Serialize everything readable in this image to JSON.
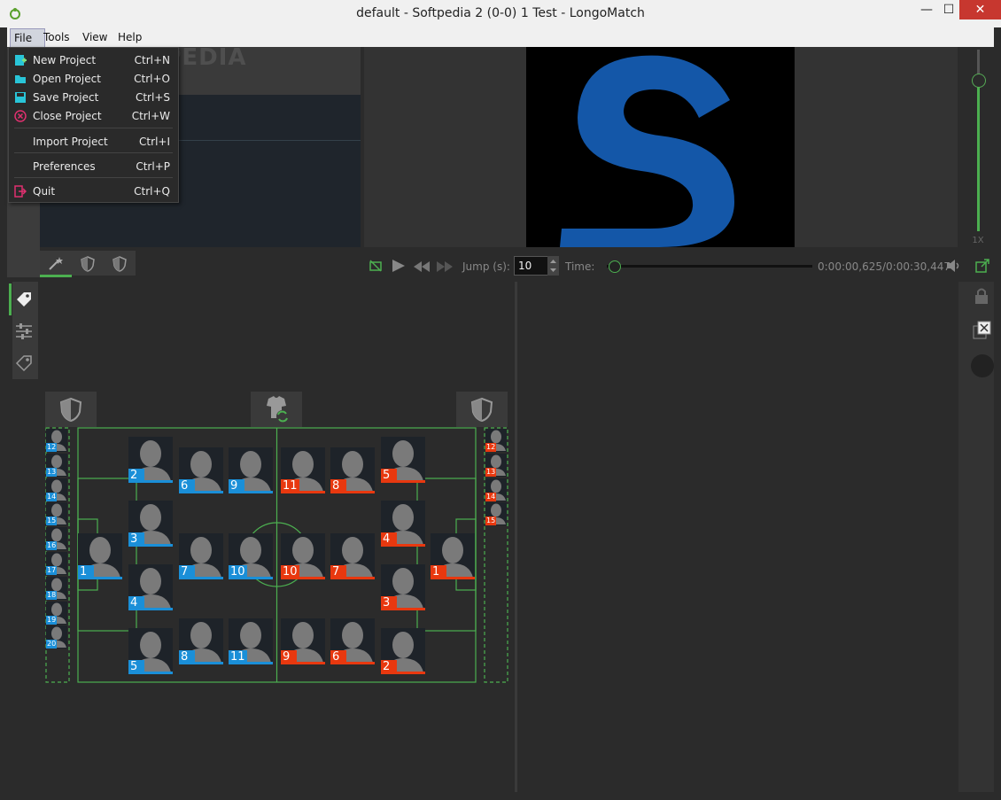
{
  "window": {
    "title": "default - Softpedia 2 (0-0) 1 Test - LongoMatch",
    "minimize": "—",
    "maximize": "☐",
    "close": "✕"
  },
  "menubar": {
    "file": "File",
    "tools": "Tools",
    "view": "View",
    "help": "Help"
  },
  "file_menu": {
    "items": [
      {
        "label": "New Project",
        "shortcut": "Ctrl+N",
        "icon": "new-project-icon"
      },
      {
        "label": "Open Project",
        "shortcut": "Ctrl+O",
        "icon": "open-folder-icon"
      },
      {
        "label": "Save Project",
        "shortcut": "Ctrl+S",
        "icon": "save-icon"
      },
      {
        "label": "Close Project",
        "shortcut": "Ctrl+W",
        "icon": "close-circle-icon"
      },
      {
        "label": "Import Project",
        "shortcut": "Ctrl+I"
      },
      {
        "label": "Preferences",
        "shortcut": "Ctrl+P"
      },
      {
        "label": "Quit",
        "shortcut": "Ctrl+Q",
        "icon": "quit-icon"
      }
    ]
  },
  "watermark": "SOFTPEDIA",
  "playback": {
    "jump_label": "Jump (s):",
    "jump_value": "10",
    "time_label": "Time:",
    "time_value": "0:00:00,625/0:00:30,447",
    "rate": "1X",
    "progress": 0.02
  },
  "team_colors": {
    "home": "#1a8fd8",
    "away": "#e8380f",
    "field_line": "#4caf50"
  },
  "home_players": [
    {
      "n": "1"
    },
    {
      "n": "2"
    },
    {
      "n": "3"
    },
    {
      "n": "4"
    },
    {
      "n": "5"
    },
    {
      "n": "6"
    },
    {
      "n": "7"
    },
    {
      "n": "8"
    },
    {
      "n": "9"
    },
    {
      "n": "10"
    },
    {
      "n": "11"
    }
  ],
  "away_players": [
    {
      "n": "1"
    },
    {
      "n": "2"
    },
    {
      "n": "3"
    },
    {
      "n": "4"
    },
    {
      "n": "5"
    },
    {
      "n": "6"
    },
    {
      "n": "7"
    },
    {
      "n": "8"
    },
    {
      "n": "9"
    },
    {
      "n": "10"
    },
    {
      "n": "11"
    }
  ],
  "home_subs": [
    "12",
    "13",
    "14",
    "15",
    "16",
    "17",
    "18",
    "19",
    "20"
  ],
  "away_subs": [
    "12",
    "13",
    "14",
    "15"
  ]
}
